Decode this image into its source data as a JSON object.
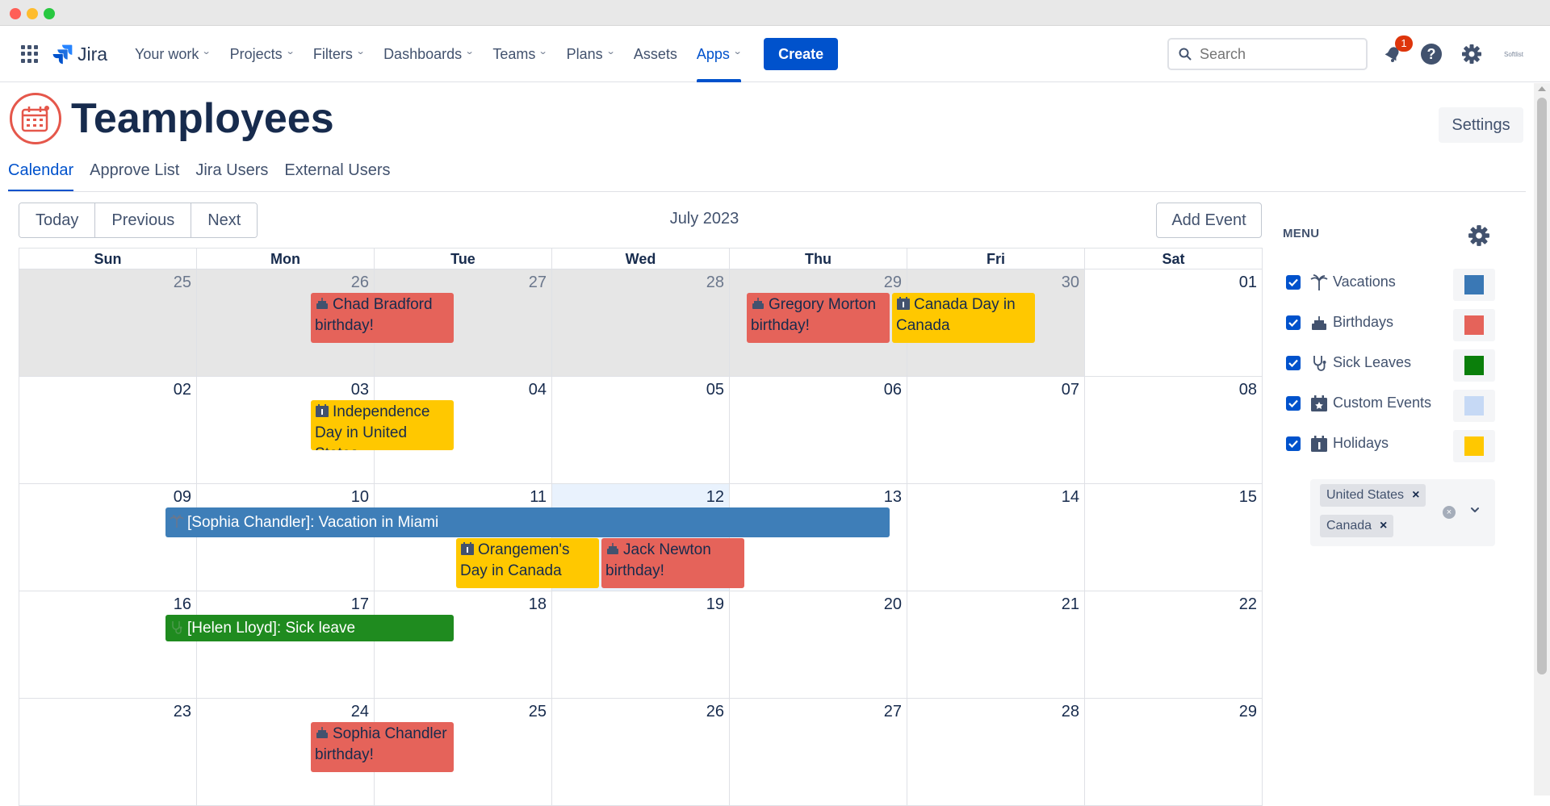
{
  "topbar": {
    "product": "Jira",
    "nav": [
      {
        "label": "Your work",
        "dropdown": true
      },
      {
        "label": "Projects",
        "dropdown": true
      },
      {
        "label": "Filters",
        "dropdown": true
      },
      {
        "label": "Dashboards",
        "dropdown": true
      },
      {
        "label": "Teams",
        "dropdown": true
      },
      {
        "label": "Plans",
        "dropdown": true
      },
      {
        "label": "Assets",
        "dropdown": false
      },
      {
        "label": "Apps",
        "dropdown": true,
        "active": true
      }
    ],
    "create_label": "Create",
    "search_placeholder": "Search",
    "notification_count": "1",
    "avatar_text": "Softlist"
  },
  "app": {
    "title": "Teamployees",
    "settings_label": "Settings",
    "tabs": [
      "Calendar",
      "Approve List",
      "Jira Users",
      "External Users"
    ]
  },
  "calendar": {
    "today_label": "Today",
    "previous_label": "Previous",
    "next_label": "Next",
    "month_title": "July 2023",
    "add_event_label": "Add Event",
    "weekdays": [
      "Sun",
      "Mon",
      "Tue",
      "Wed",
      "Thu",
      "Fri",
      "Sat"
    ],
    "weeks": [
      {
        "days": [
          "25",
          "26",
          "27",
          "28",
          "29",
          "30",
          "01"
        ],
        "other": [
          true,
          true,
          true,
          true,
          true,
          true,
          false
        ]
      },
      {
        "days": [
          "02",
          "03",
          "04",
          "05",
          "06",
          "07",
          "08"
        ],
        "other": [
          false,
          false,
          false,
          false,
          false,
          false,
          false
        ]
      },
      {
        "days": [
          "09",
          "10",
          "11",
          "12",
          "13",
          "14",
          "15"
        ],
        "other": [
          false,
          false,
          false,
          false,
          false,
          false,
          false
        ],
        "today": 3
      },
      {
        "days": [
          "16",
          "17",
          "18",
          "19",
          "20",
          "21",
          "22"
        ],
        "other": [
          false,
          false,
          false,
          false,
          false,
          false,
          false
        ]
      },
      {
        "days": [
          "23",
          "24",
          "25",
          "26",
          "27",
          "28",
          "29"
        ],
        "other": [
          false,
          false,
          false,
          false,
          false,
          false,
          false
        ]
      }
    ],
    "events": [
      {
        "week": 0,
        "start": 2,
        "span": 1,
        "row": 0,
        "type": "birthday",
        "text": "Chad Bradford birthday!"
      },
      {
        "week": 0,
        "start": 5,
        "span": 1,
        "row": 0,
        "type": "birthday",
        "text": "Gregory Morton birthday!"
      },
      {
        "week": 0,
        "start": 6,
        "span": 1,
        "row": 0,
        "type": "holiday",
        "text": "Canada Day in Canada"
      },
      {
        "week": 1,
        "start": 2,
        "span": 1,
        "row": 0,
        "type": "holiday",
        "text": "Independence Day in United States"
      },
      {
        "week": 2,
        "start": 1,
        "span": 5,
        "row": 0,
        "type": "vacation",
        "text": "[Sophia Chandler]: Vacation in Miami"
      },
      {
        "week": 2,
        "start": 3,
        "span": 1,
        "row": 1,
        "type": "holiday",
        "text": "Orangemen's Day in Canada"
      },
      {
        "week": 2,
        "start": 4,
        "span": 1,
        "row": 1,
        "type": "birthday",
        "text": "Jack Newton birthday!"
      },
      {
        "week": 3,
        "start": 1,
        "span": 2,
        "row": 0,
        "type": "sick",
        "text": "[Helen Lloyd]: Sick leave"
      },
      {
        "week": 4,
        "start": 2,
        "span": 1,
        "row": 0,
        "type": "birthday",
        "text": "Sophia Chandler birthday!"
      }
    ]
  },
  "menu": {
    "title": "MENU",
    "items": [
      {
        "label": "Vacations",
        "icon": "palm-tree-icon",
        "color": "#3a78b5",
        "checked": true
      },
      {
        "label": "Birthdays",
        "icon": "cake-icon",
        "color": "#e5635a",
        "checked": true
      },
      {
        "label": "Sick Leaves",
        "icon": "stethoscope-icon",
        "color": "#0b7f0b",
        "checked": true
      },
      {
        "label": "Custom Events",
        "icon": "calendar-star-icon",
        "color": "#c6d9f5",
        "checked": true
      },
      {
        "label": "Holidays",
        "icon": "calendar-holiday-icon",
        "color": "#ffc800",
        "checked": true
      }
    ],
    "countries": [
      "United States",
      "Canada"
    ]
  },
  "colors": {
    "accent": "#0052cc",
    "birthday": "#e5635a",
    "holiday": "#ffc800",
    "vacation": "#3e7eb8",
    "sick": "#1f8b1f"
  }
}
